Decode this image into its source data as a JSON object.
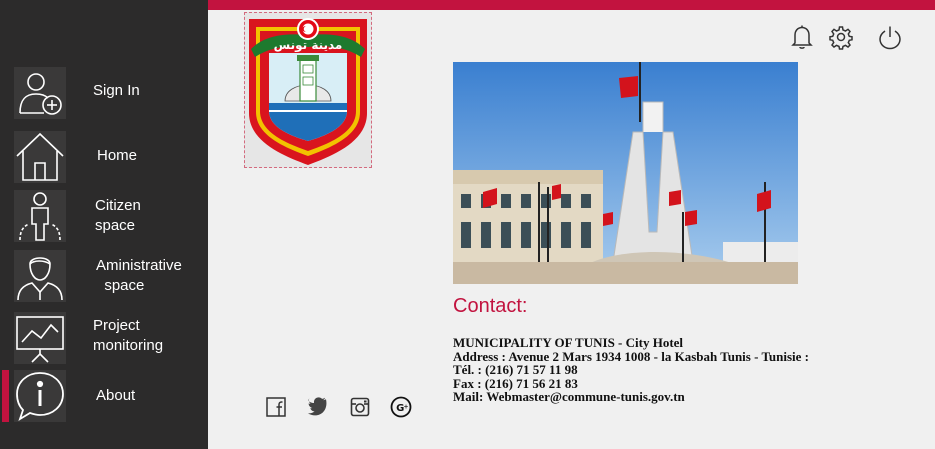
{
  "sidebar": {
    "items": [
      {
        "label": "Sign In",
        "icon": "user-add-icon"
      },
      {
        "label": "Home",
        "icon": "home-icon"
      },
      {
        "label": "Citizen\nspace",
        "icon": "citizen-icon"
      },
      {
        "label": "Aministrative\n  space",
        "icon": "administrative-person-icon"
      },
      {
        "label": "Project\nmonitoring",
        "icon": "presentation-chart-icon"
      },
      {
        "label": "About",
        "icon": "info-speech-bubble-icon"
      }
    ],
    "active_index": 5
  },
  "header": {
    "icons": [
      "bell-icon",
      "gear-icon",
      "power-icon"
    ]
  },
  "emblem": {
    "banner_text": "مدينة تونس",
    "icon": "tunis-city-emblem"
  },
  "main": {
    "photo": {
      "icon": "kasbah-square-monument-photo"
    },
    "contact_title": "Contact:",
    "contact_lines": [
      "MUNICIPALITY OF TUNIS - City Hotel",
      "Address : Avenue 2 Mars 1934 1008 - la Kasbah Tunis - Tunisie :",
      "Tél. : (216) 71 57 11 98",
      "Fax : (216) 71 56 21 83",
      "Mail: Webmaster@commune-tunis.gov.tn"
    ]
  },
  "social": {
    "icons": [
      "facebook-icon",
      "twitter-icon",
      "instagram-icon",
      "google-plus-icon"
    ]
  },
  "colors": {
    "accent": "#c2133f",
    "sidebar_bg": "#2c2b2b",
    "page_bg": "#f0f0f0"
  }
}
